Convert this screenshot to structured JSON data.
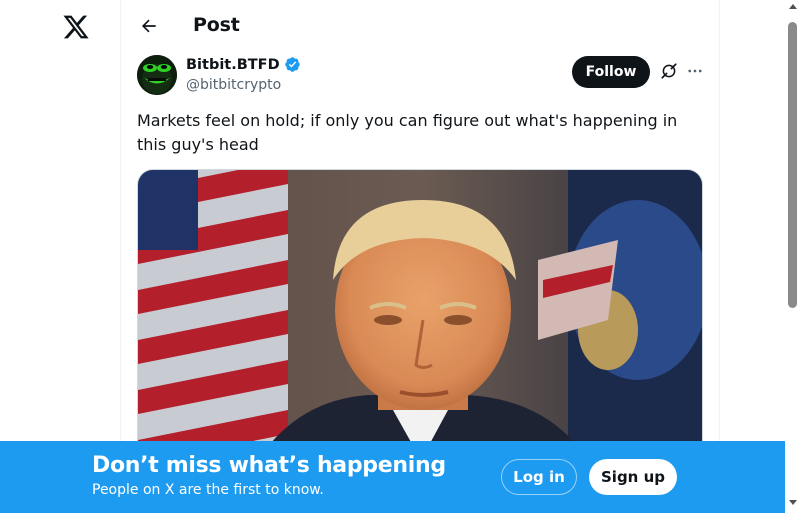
{
  "header": {
    "title": "Post"
  },
  "post": {
    "display_name": "Bitbit.BTFD",
    "handle": "@bitbitcrypto",
    "text": "Markets feel on hold; if only you can figure out what's happening in this guy's head",
    "follow_label": "Follow"
  },
  "banner": {
    "title": "Don’t miss what’s happening",
    "subtitle": "People on X are the first to know.",
    "login_label": "Log in",
    "signup_label": "Sign up"
  },
  "icons": {
    "logo": "x-logo",
    "back": "arrow-left-icon",
    "verified": "verified-badge-icon",
    "grok": "grok-icon",
    "more": "more-horizontal-icon"
  },
  "colors": {
    "accent": "#1d9bf0",
    "text": "#0f1419",
    "secondary_text": "#536471",
    "follow_button": "#0f1419"
  }
}
